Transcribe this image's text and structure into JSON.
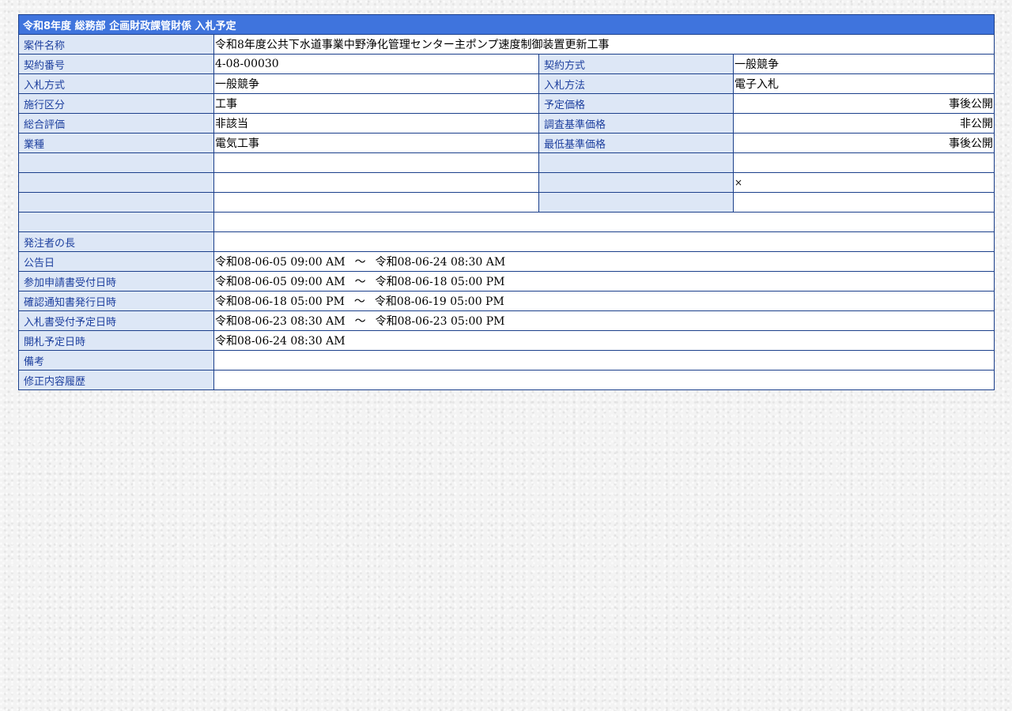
{
  "title": "令和8年度 総務部 企画財政課管財係 入札予定",
  "project_name": {
    "label": "案件名称",
    "value": "令和8年度公共下水道事業中野浄化管理センター主ポンプ速度制御装置更新工事"
  },
  "contract_no": {
    "label": "契約番号",
    "value": "4-08-00030"
  },
  "contract_method": {
    "label": "契約方式",
    "value": "一般競争"
  },
  "bid_type": {
    "label": "入札方式",
    "value": "一般競争"
  },
  "bid_method": {
    "label": "入札方法",
    "value": "電子入札"
  },
  "category": {
    "label": "施行区分",
    "value": "工事"
  },
  "planned_price": {
    "label": "予定価格",
    "value": "事後公開"
  },
  "comprehensive_eval": {
    "label": "総合評価",
    "value": "非該当"
  },
  "survey_base_price": {
    "label": "調査基準価格",
    "value": "非公開"
  },
  "industry": {
    "label": "業種",
    "value": "電気工事"
  },
  "min_base_price": {
    "label": "最低基準価格",
    "value": "事後公開"
  },
  "blank_row2_mark": "×",
  "orderer_head": {
    "label": "発注者の長",
    "value": ""
  },
  "announce": {
    "label": "公告日",
    "start": "令和08-06-05 09:00 AM",
    "sep": "～",
    "end": "令和08-06-24 08:30 AM"
  },
  "application": {
    "label": "参加申請書受付日時",
    "start": "令和08-06-05 09:00 AM",
    "sep": "～",
    "end": "令和08-06-18 05:00 PM"
  },
  "confirmation": {
    "label": "確認通知書発行日時",
    "start": "令和08-06-18 05:00 PM",
    "sep": "～",
    "end": "令和08-06-19 05:00 PM"
  },
  "bid_receipt": {
    "label": "入札書受付予定日時",
    "start": "令和08-06-23 08:30 AM",
    "sep": "～",
    "end": "令和08-06-23 05:00 PM"
  },
  "opening": {
    "label": "開札予定日時",
    "value": "令和08-06-24 08:30 AM"
  },
  "remarks": {
    "label": "備考",
    "value": ""
  },
  "revision_history": {
    "label": "修正内容履歴",
    "value": ""
  }
}
